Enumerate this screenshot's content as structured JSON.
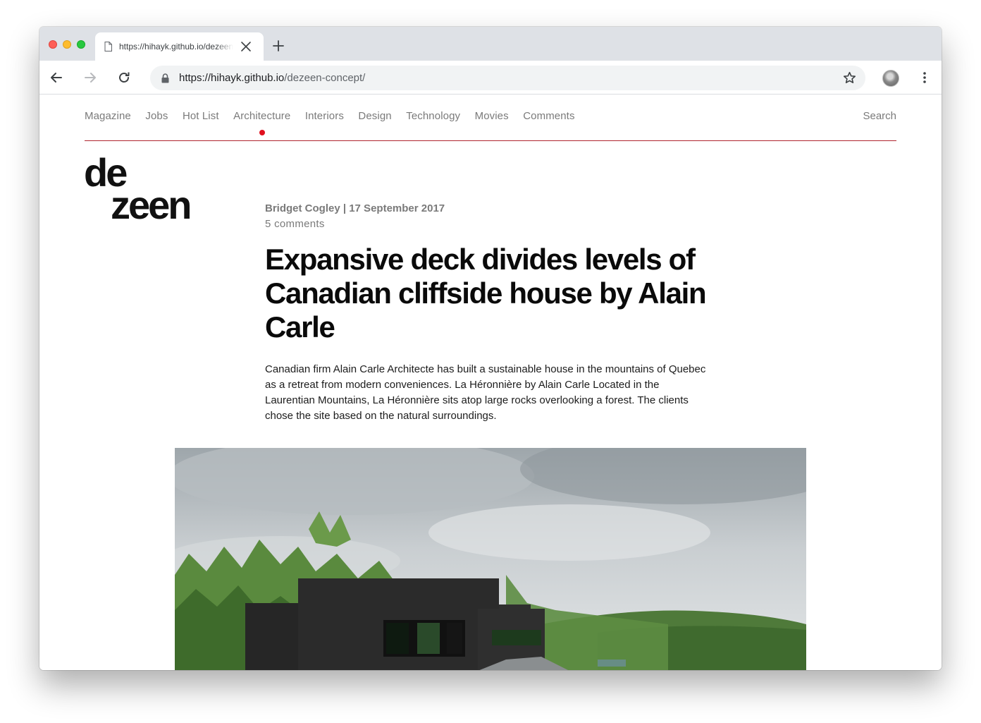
{
  "browser": {
    "tab_title": "https://hihayk.github.io/dezeen-concept/",
    "url_host": "https://hihayk.github.io",
    "url_path": "/dezeen-concept/"
  },
  "site": {
    "nav": [
      "Magazine",
      "Jobs",
      "Hot List",
      "Architecture",
      "Interiors",
      "Design",
      "Technology",
      "Movies",
      "Comments"
    ],
    "active_nav": "Architecture",
    "search_label": "Search",
    "logo_top": "de",
    "logo_bottom": "zeen",
    "accent_color": "#b0242e",
    "active_dot_color": "#e0101e"
  },
  "article": {
    "byline": "Bridget Cogley | 17 September 2017",
    "comments": "5 comments",
    "headline": "Expansive deck divides levels of Canadian cliffside house by Alain Carle",
    "dek": "Canadian firm Alain Carle Architecte has built a sustainable house in the mountains of Quebec as a retreat from modern conveniences. La Héronnière by Alain Carle Located in the Laurentian Mountains, La Héronnière sits atop large rocks overlooking a forest. The clients chose the site based on the natural surroundings."
  }
}
